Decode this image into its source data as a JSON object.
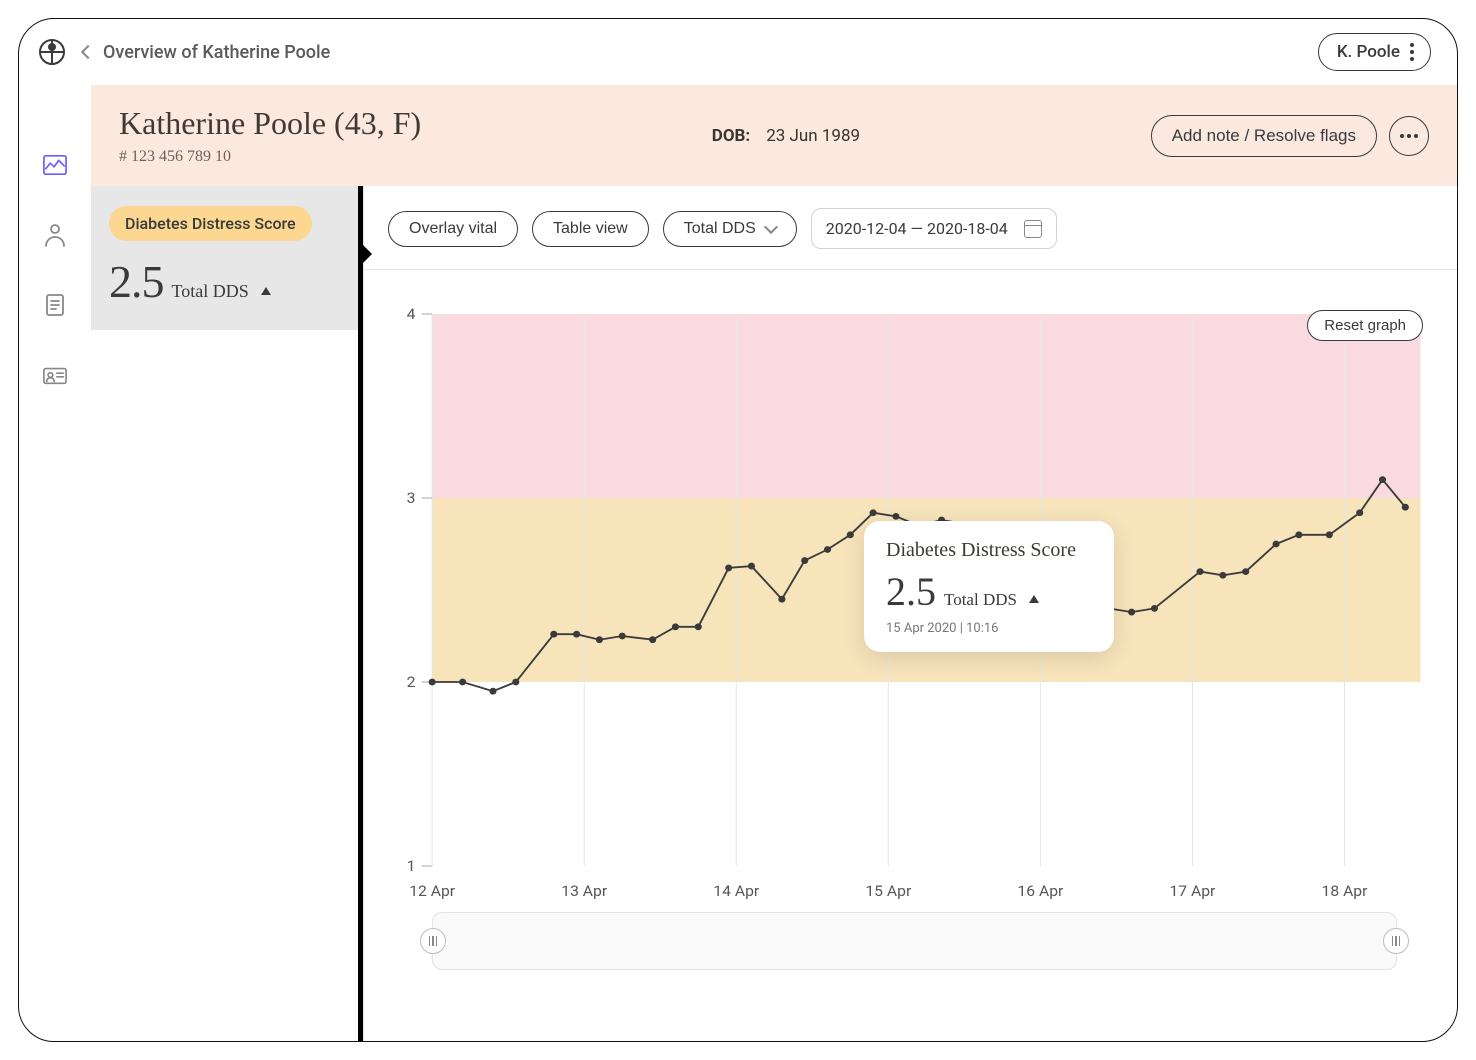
{
  "header": {
    "breadcrumb_label": "Overview of Katherine Poole",
    "user_label": "K. Poole"
  },
  "rail": {
    "items": [
      "chart",
      "user",
      "document",
      "id-card"
    ],
    "active_index": 0
  },
  "banner": {
    "name_line": "Katherine Poole (43,  F)",
    "id_line": "# 123 456 789 10",
    "dob_label": "DOB:",
    "dob_value": "23 Jun 1989",
    "primary_action": "Add note / Resolve flags"
  },
  "left_panel": {
    "chip_label": "Diabetes Distress Score",
    "value": "2.5",
    "sub_label": "Total DDS"
  },
  "toolbar": {
    "btn_overlay": "Overlay vital",
    "btn_table": "Table view",
    "btn_total": "Total DDS",
    "date_range": "2020-12-04 — 2020-18-04"
  },
  "chart": {
    "reset_label": "Reset graph"
  },
  "tooltip": {
    "title": "Diabetes Distress Score",
    "value": "2.5",
    "sub": "Total DDS",
    "timestamp": "15 Apr 2020 | 10:16"
  },
  "chart_data": {
    "type": "line",
    "title": "Diabetes Distress Score",
    "xlabel": "",
    "ylabel": "",
    "ylim": [
      1,
      4
    ],
    "y_ticks": [
      1,
      2,
      3,
      4
    ],
    "x_ticks": [
      "12 Apr",
      "13 Apr",
      "14 Apr",
      "15 Apr",
      "16 Apr",
      "17 Apr",
      "18 Apr"
    ],
    "bands": [
      {
        "from": 3,
        "to": 4,
        "color": "#f9dae1"
      },
      {
        "from": 2,
        "to": 3,
        "color": "#f7e4bb"
      }
    ],
    "series": [
      {
        "name": "Total DDS",
        "x": [
          12.0,
          12.2,
          12.4,
          12.55,
          12.8,
          12.95,
          13.1,
          13.25,
          13.45,
          13.6,
          13.75,
          13.95,
          14.1,
          14.3,
          14.45,
          14.6,
          14.75,
          14.9,
          15.05,
          15.2,
          15.35,
          15.8,
          15.9,
          16.1,
          16.3,
          16.45,
          16.6,
          16.75,
          17.05,
          17.2,
          17.35,
          17.55,
          17.7,
          17.9,
          18.1,
          18.25,
          18.4
        ],
        "values": [
          2.0,
          2.0,
          1.95,
          2.0,
          2.26,
          2.26,
          2.23,
          2.25,
          2.23,
          2.3,
          2.3,
          2.62,
          2.63,
          2.45,
          2.66,
          2.72,
          2.8,
          2.92,
          2.9,
          2.85,
          2.88,
          2.82,
          2.75,
          2.5,
          2.33,
          2.4,
          2.38,
          2.4,
          2.6,
          2.58,
          2.6,
          2.75,
          2.8,
          2.8,
          2.92,
          3.1,
          2.95
        ]
      }
    ]
  }
}
